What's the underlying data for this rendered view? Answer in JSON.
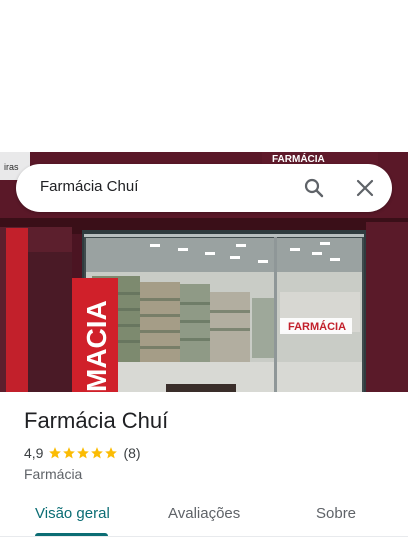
{
  "search": {
    "query": "Farmácia Chuí"
  },
  "icons": {
    "search": "search-icon",
    "close": "close-icon",
    "star": "star-icon"
  },
  "photo": {
    "storefront_sign_text": "FARMÁCIA",
    "glass_sign_text": "FARMÁCIA",
    "banner_text": "MACIA"
  },
  "place": {
    "name": "Farmácia Chuí",
    "rating": "4,9",
    "stars": 5,
    "review_count": "(8)",
    "category": "Farmácia"
  },
  "tabs": [
    {
      "label": "Visão geral",
      "active": true
    },
    {
      "label": "Avaliações",
      "active": false
    },
    {
      "label": "Sobre",
      "active": false
    }
  ],
  "colors": {
    "accent": "#0b6d74",
    "star": "#fbbc04",
    "brand_red": "#d0202a"
  }
}
